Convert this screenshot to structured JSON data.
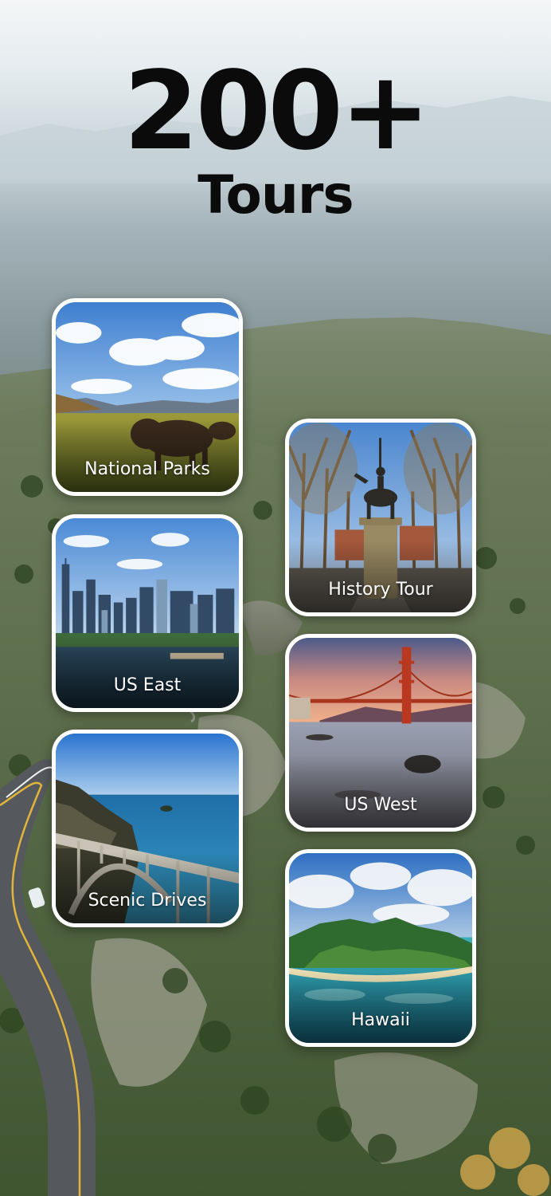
{
  "headline": {
    "number": "200+",
    "subtitle": "Tours"
  },
  "tours": [
    {
      "label": "National Parks",
      "icon": "bison-prairie-image"
    },
    {
      "label": "History Tour",
      "icon": "statue-park-image"
    },
    {
      "label": "US East",
      "icon": "city-skyline-image"
    },
    {
      "label": "US West",
      "icon": "golden-gate-bridge-image"
    },
    {
      "label": "Scenic Drives",
      "icon": "coastal-bridge-image"
    },
    {
      "label": "Hawaii",
      "icon": "tropical-island-image"
    }
  ],
  "colors": {
    "headline": "#0b0b0b",
    "card_border": "#ffffff",
    "label": "#ffffff"
  }
}
